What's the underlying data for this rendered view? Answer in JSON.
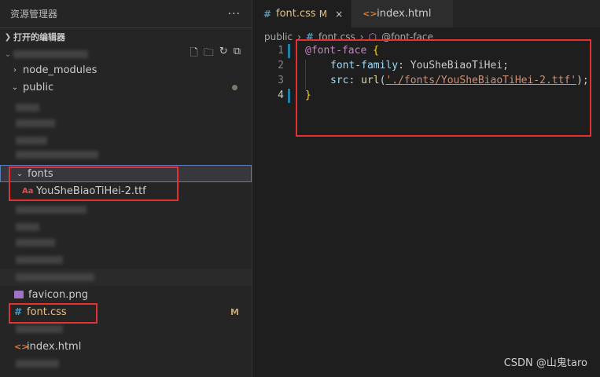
{
  "explorer": {
    "title": "资源管理器",
    "more": "···",
    "open_editors": "打开的编辑器",
    "actions": [
      "new-file",
      "new-folder",
      "refresh",
      "collapse"
    ]
  },
  "tree": {
    "node_modules": "node_modules",
    "public": "public",
    "fonts": "fonts",
    "font_file": "YouSheBiaoTiHei-2.ttf",
    "favicon": "favicon.png",
    "font_css": "font.css",
    "font_css_status": "M",
    "index_html": "index.html"
  },
  "tabs": [
    {
      "label": "font.css",
      "status": "M",
      "icon": "hash-icon",
      "close": "×"
    },
    {
      "label": "index.html",
      "icon": "html-icon"
    }
  ],
  "breadcrumb": {
    "folder": "public",
    "file": "font.css",
    "symbol": "@font-face"
  },
  "code": {
    "line_numbers": [
      "1",
      "2",
      "3",
      "4"
    ],
    "l1_at": "@font-face",
    "l1_brace": "{",
    "l2_prop": "font-family",
    "l2_val": "YouSheBiaoTiHei;",
    "l3_prop": "src",
    "l3_fn": "url",
    "l3_str": "'./fonts/YouSheBiaoTiHei-2.ttf'",
    "l3_end": ");",
    "l4_brace": "}"
  },
  "watermark": "CSDN @山鬼taro",
  "colors": {
    "accent_red": "#e53030",
    "modified": "#e2c08d",
    "css_icon": "#519aba"
  }
}
